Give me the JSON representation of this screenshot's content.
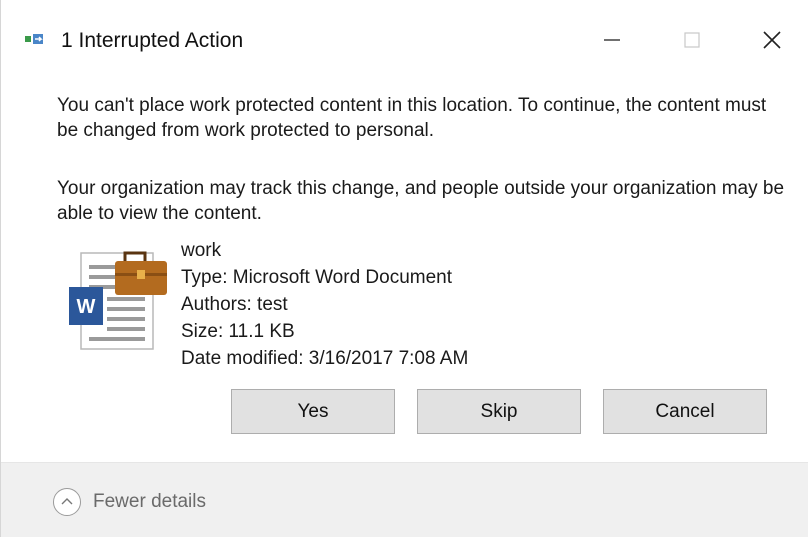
{
  "window": {
    "title": "1 Interrupted Action",
    "app_icon": "file-move-icon",
    "controls": {
      "minimize": "minimize-icon",
      "maximize": "maximize-icon",
      "close": "close-icon"
    }
  },
  "message": {
    "line1": "You can't place work protected content in this location. To continue, the content must be changed from work protected to personal.",
    "line2": "Your organization may track this change, and people outside your organization may be able to view the content."
  },
  "file": {
    "icon": "word-document-work-icon",
    "name": "work",
    "type": "Type: Microsoft Word Document",
    "authors": "Authors: test",
    "size": "Size: 11.1 KB",
    "date_modified": "Date modified: 3/16/2017 7:08 AM"
  },
  "buttons": {
    "yes": "Yes",
    "skip": "Skip",
    "cancel": "Cancel"
  },
  "footer": {
    "toggle_icon": "chevron-up-circle-icon",
    "toggle_label": "Fewer details"
  },
  "colors": {
    "word_blue": "#2b579a",
    "briefcase_brown": "#b36b1f",
    "button_bg": "#e1e1e1",
    "footer_bg": "#f0f0f0"
  }
}
